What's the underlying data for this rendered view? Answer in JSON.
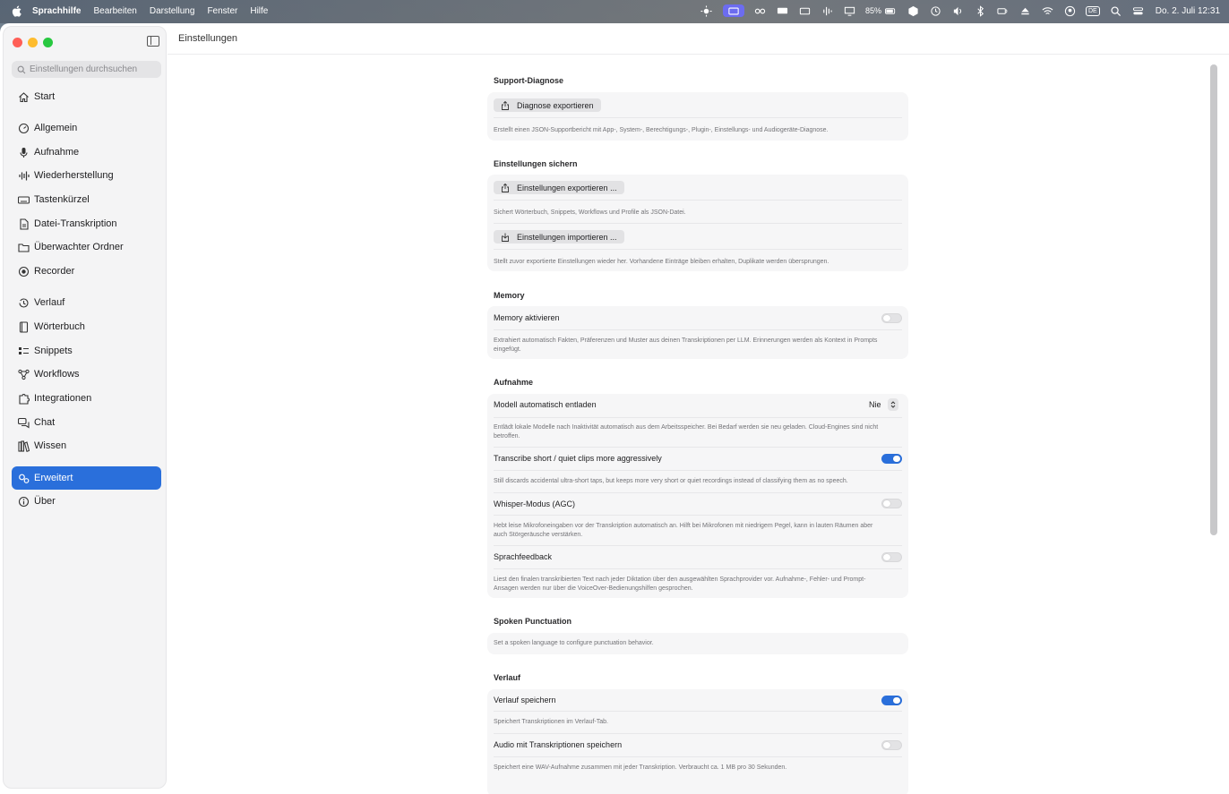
{
  "menubar": {
    "app_name": "Sprachhilfe",
    "menus": [
      "Bearbeiten",
      "Darstellung",
      "Fenster",
      "Hilfe"
    ],
    "battery_text": "85%",
    "keyboard_layout": "DE",
    "datetime": "Do. 2. Juli  12:31"
  },
  "window": {
    "title": "Einstellungen"
  },
  "sidebar": {
    "search_placeholder": "Einstellungen durchsuchen",
    "items": [
      {
        "label": "Start",
        "icon": "house-icon"
      },
      {
        "label": "Allgemein",
        "icon": "gauge-icon"
      },
      {
        "label": "Aufnahme",
        "icon": "microphone-icon"
      },
      {
        "label": "Wiederherstellung",
        "icon": "waveform-icon"
      },
      {
        "label": "Tastenkürzel",
        "icon": "keyboard-icon"
      },
      {
        "label": "Datei-Transkription",
        "icon": "document-icon"
      },
      {
        "label": "Überwachter Ordner",
        "icon": "folder-icon"
      },
      {
        "label": "Recorder",
        "icon": "record-icon"
      },
      {
        "label": "Verlauf",
        "icon": "history-icon"
      },
      {
        "label": "Wörterbuch",
        "icon": "book-icon"
      },
      {
        "label": "Snippets",
        "icon": "snippets-icon"
      },
      {
        "label": "Workflows",
        "icon": "workflow-icon"
      },
      {
        "label": "Integrationen",
        "icon": "puzzle-icon"
      },
      {
        "label": "Chat",
        "icon": "chat-icon"
      },
      {
        "label": "Wissen",
        "icon": "books-icon"
      },
      {
        "label": "Erweitert",
        "icon": "gears-icon",
        "active": true
      },
      {
        "label": "Über",
        "icon": "info-icon"
      }
    ]
  },
  "sections": {
    "support": {
      "title": "Support-Diagnose",
      "button": "Diagnose exportieren",
      "desc": "Erstellt einen JSON-Supportbericht mit App-, System-, Berechtigungs-, Plugin-, Einstellungs- und Audiogeräte-Diagnose."
    },
    "backup": {
      "title": "Einstellungen sichern",
      "export_button": "Einstellungen exportieren ...",
      "export_desc": "Sichert Wörterbuch, Snippets, Workflows und Profile als JSON-Datei.",
      "import_button": "Einstellungen importieren ...",
      "import_desc": "Stellt zuvor exportierte Einstellungen wieder her. Vorhandene Einträge bleiben erhalten, Duplikate werden übersprungen."
    },
    "memory": {
      "title": "Memory",
      "label": "Memory aktivieren",
      "desc": "Extrahiert automatisch Fakten, Präferenzen und Muster aus deinen Transkriptionen per LLM. Erinnerungen werden als Kontext in Prompts eingefügt."
    },
    "recording": {
      "title": "Aufnahme",
      "unload_label": "Modell automatisch entladen",
      "unload_value": "Nie",
      "unload_desc": "Entlädt lokale Modelle nach Inaktivität automatisch aus dem Arbeitsspeicher. Bei Bedarf werden sie neu geladen. Cloud-Engines sind nicht betroffen.",
      "short_label": "Transcribe short / quiet clips more aggressively",
      "short_desc": "Still discards accidental ultra-short taps, but keeps more very short or quiet recordings instead of classifying them as no speech.",
      "whisper_label": "Whisper-Modus (AGC)",
      "whisper_desc": "Hebt leise Mikrofoneingaben vor der Transkription automatisch an. Hilft bei Mikrofonen mit niedrigem Pegel, kann in lauten Räumen aber auch Störgeräusche verstärken.",
      "feedback_label": "Sprachfeedback",
      "feedback_desc": "Liest den finalen transkribierten Text nach jeder Diktation über den ausgewählten Sprachprovider vor. Aufnahme-, Fehler- und Prompt-Ansagen werden nur über die VoiceOver-Bedienungshilfen gesprochen."
    },
    "punctuation": {
      "title": "Spoken Punctuation",
      "desc": "Set a spoken language to configure punctuation behavior."
    },
    "history": {
      "title": "Verlauf",
      "save_label": "Verlauf speichern",
      "save_desc": "Speichert Transkriptionen im Verlauf-Tab.",
      "audio_label": "Audio mit Transkriptionen speichern",
      "audio_desc": "Speichert eine WAV-Aufnahme zusammen mit jeder Transkription. Verbraucht ca. 1 MB pro 30 Sekunden."
    }
  },
  "toggles": {
    "memory": false,
    "short_clips": true,
    "whisper": false,
    "feedback": false,
    "history_save": true,
    "history_audio": false
  },
  "colors": {
    "accent": "#2a6fdb",
    "sidebar_bg": "#f4f4f5",
    "card_bg": "#f6f6f7"
  }
}
